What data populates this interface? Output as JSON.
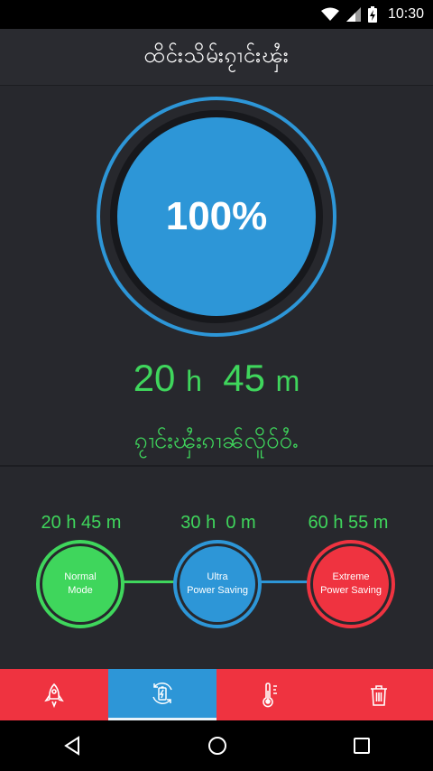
{
  "status_bar": {
    "time": "10:30"
  },
  "header": {
    "title": "ထိင်းသိမ်းၵႂၢင်းၾႆး"
  },
  "battery": {
    "percent_text": "100%"
  },
  "remaining": {
    "hours": "20",
    "h_unit": "h",
    "minutes": "45",
    "m_unit": "m",
    "label": "ၵႂၢင်းၾႆးၵၢၼ်လိူဝ်ဝႆႉ"
  },
  "modes": [
    {
      "time": "20 h 45 m",
      "line1": "Normal",
      "line2": "Mode",
      "color": "#3fd65c"
    },
    {
      "time": "30 h  0 m",
      "line1": "Ultra",
      "line2": "Power Saving",
      "color": "#2d96d7"
    },
    {
      "time": "60 h 55 m",
      "line1": "Extreme",
      "line2": "Power Saving",
      "color": "#ef3340"
    }
  ],
  "tabs": [
    {
      "icon": "rocket-icon"
    },
    {
      "icon": "battery-refresh-icon",
      "active": true
    },
    {
      "icon": "thermometer-icon"
    },
    {
      "icon": "trash-icon"
    }
  ],
  "colors": {
    "accent_blue": "#2d96d7",
    "green": "#3fd65c",
    "red": "#ef3340",
    "background": "#27282d"
  }
}
